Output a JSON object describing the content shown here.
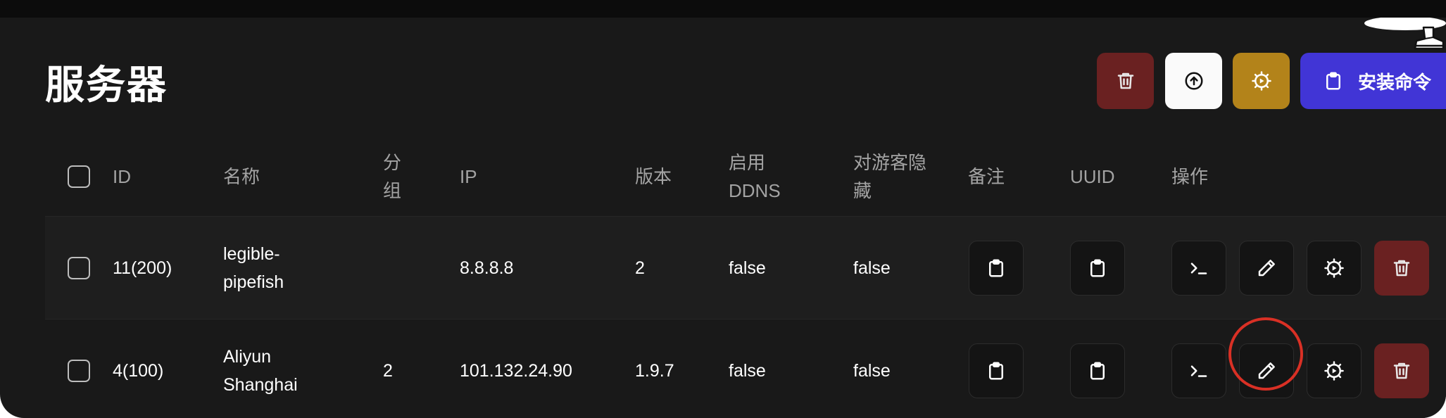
{
  "page": {
    "title": "服务器"
  },
  "header_actions": {
    "install_label": "安装命令"
  },
  "colors": {
    "delete_red": "#6a2121",
    "settings_gold": "#b3831a",
    "install_indigo": "#4135d6",
    "highlight": "#d93025",
    "background": "#191919"
  },
  "table": {
    "columns": {
      "id": "ID",
      "name": "名称",
      "group": "分组",
      "ip": "IP",
      "version": "版本",
      "ddns": "启用 DDNS",
      "hidden": "对游客隐藏",
      "note": "备注",
      "uuid": "UUID",
      "actions": "操作"
    },
    "rows": [
      {
        "id": "11(200)",
        "name": "legible-pipefish",
        "group": "",
        "ip": "8.8.8.8",
        "version": "2",
        "ddns": "false",
        "hidden": "false"
      },
      {
        "id": "4(100)",
        "name": "Aliyun Shanghai",
        "group": "2",
        "ip": "101.132.24.90",
        "version": "1.9.7",
        "ddns": "false",
        "hidden": "false"
      }
    ]
  },
  "icons": {
    "trash": "trash-icon",
    "upload": "arrow-up-circle-icon",
    "settings": "gear-icon",
    "clipboard": "clipboard-icon",
    "terminal": "terminal-icon",
    "edit": "pencil-icon"
  }
}
